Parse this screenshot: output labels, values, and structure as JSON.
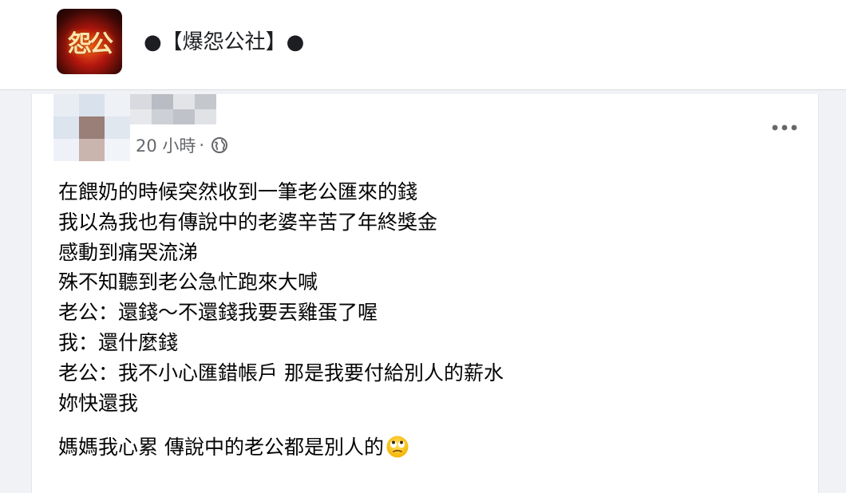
{
  "group": {
    "name": "●【爆怨公社】●",
    "logo_icon": "flame-logo-icon",
    "logo_text": "怨公"
  },
  "post": {
    "author_avatar": "blurred-avatar",
    "author_name": "",
    "time": "20 小時",
    "separator": "·",
    "privacy_icon": "globe-icon",
    "more_icon": "more-options-icon",
    "lines": [
      "在餵奶的時候突然收到一筆老公匯來的錢",
      "我以為我也有傳說中的老婆辛苦了年終獎金",
      "感動到痛哭流涕",
      "殊不知聽到老公急忙跑來大喊",
      "老公：還錢～不還錢我要丟雞蛋了喔",
      "我：還什麼錢",
      "老公：我不小心匯錯帳戶 那是我要付給別人的薪水",
      "妳快還我"
    ],
    "closing_line": "媽媽我心累 傳說中的老公都是別人的",
    "closing_emoji": "rolling-eyes-emoji-icon"
  }
}
